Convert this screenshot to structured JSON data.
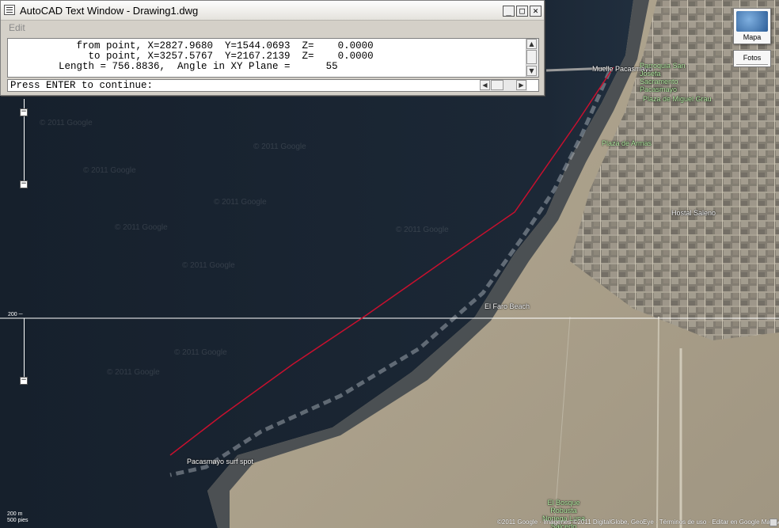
{
  "window": {
    "title": "AutoCAD Text Window - Drawing1.dwg",
    "menu_edit": "Edit",
    "output_lines": [
      "           from point, X=2827.9680  Y=1544.0693  Z=    0.0000",
      "             to point, X=3257.5767  Y=2167.2139  Z=    0.0000",
      "        Length = 756.8836,  Angle in XY Plane =      55"
    ],
    "command_prompt": "Press ENTER to continue:",
    "minimize_glyph": "_",
    "maximize_glyph": "□",
    "close_glyph": "✕"
  },
  "map": {
    "type_button": "Mapa",
    "photos_button": "Fotos",
    "scale_top": "200 m",
    "scale_bottom": "500 pies",
    "ruler_label": "200 ─",
    "attribution": "©2011 Google · Imágenes ©2011 DigitalGlobe, GeoEye · Términos de uso · Editar en Google Map Maker",
    "watermark": "© 2011 Google",
    "labels": [
      {
        "text": "Muelle Pacasmayo",
        "green": false
      },
      {
        "text": "Parroquia San Josefa Sacramento Pacasmayo",
        "green": true
      },
      {
        "text": "Plaza de Miguel Grau",
        "green": true
      },
      {
        "text": "Plaza de Armas",
        "green": true
      },
      {
        "text": "El Faro Beach",
        "green": false
      },
      {
        "text": "Pacasmayo surf spot",
        "green": false
      },
      {
        "text": "El Bosque Robusta Noriega Luna Salcedo",
        "green": true
      },
      {
        "text": "Hostal Saleno",
        "green": false
      }
    ],
    "distance_line_color": "#c8102e",
    "ocean_color": "#1d2a38",
    "beach_color": "#a89c85"
  }
}
